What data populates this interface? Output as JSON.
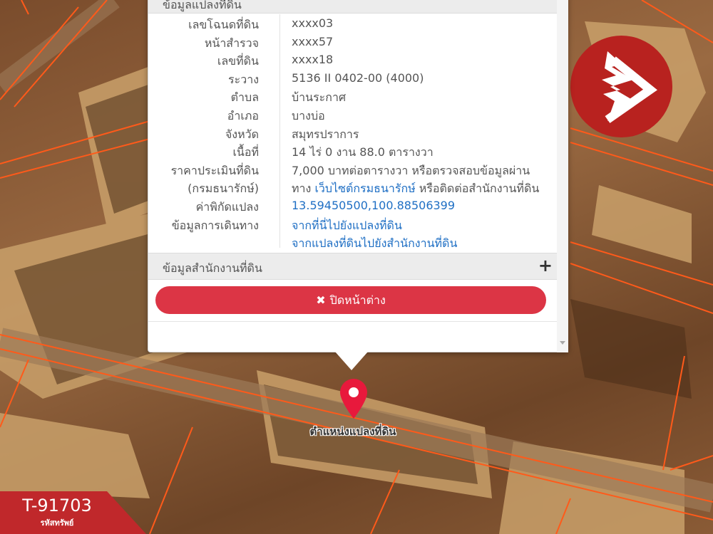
{
  "popup": {
    "top_section_title": "ข้อมูลแปลงที่ดิน",
    "rows": [
      {
        "label": "เลขโฉนดที่ดิน",
        "value": "xxxx03"
      },
      {
        "label": "หน้าสำรวจ",
        "value": "xxxx57"
      },
      {
        "label": "เลขที่ดิน",
        "value": "xxxx18"
      },
      {
        "label": "ระวาง",
        "value": "5136 II 0402-00 (4000)"
      },
      {
        "label": "ตำบล",
        "value": "บ้านระกาศ"
      },
      {
        "label": "อำเภอ",
        "value": "บางบ่อ"
      },
      {
        "label": "จังหวัด",
        "value": "สมุทรปราการ"
      },
      {
        "label": "เนื้อที่",
        "value": "14 ไร่ 0 งาน 88.0 ตารางวา"
      }
    ],
    "appraisal": {
      "label_1": "ราคาประเมินที่ดิน",
      "label_2": "(กรมธนารักษ์)",
      "value_line1": "7,000 บาทต่อตารางวา หรือตรวจสอบข้อมูลผ่าน",
      "value_line2_prefix": "ทาง",
      "value_line2_link": "เว็บไซต์กรมธนารักษ์",
      "value_line2_suffix": "หรือติดต่อสำนักงานที่ดิน"
    },
    "coordinates": {
      "label": "ค่าพิกัดแปลง",
      "value": "13.59450500,100.88506399"
    },
    "travel": {
      "label": "ข้อมูลการเดินทาง",
      "link_1": "จากที่นี่ไปยังแปลงที่ดิน",
      "link_2": "จากแปลงที่ดินไปยังสำนักงานที่ดิน"
    },
    "office_section_title": "ข้อมูลสำนักงานที่ดิน",
    "office_expand_symbol": "+",
    "close_button_label": "ปิดหน้าต่าง",
    "close_button_icon": "✖"
  },
  "marker": {
    "label": "ตำแหน่งแปลงที่ดิน",
    "color": "#e8193c"
  },
  "asset": {
    "code": "T-91703",
    "code_label": "รหัสทรัพย์"
  },
  "colors": {
    "accent_red": "#dc3545",
    "link_blue": "#1f6fc4",
    "logo_red": "#b8221f",
    "parcel_line": "#ff5a1a"
  }
}
